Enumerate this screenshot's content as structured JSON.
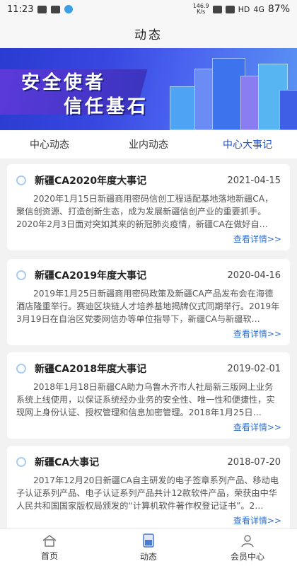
{
  "status": {
    "time": "11:23",
    "net_speed_top": "146.9",
    "net_speed_bottom": "K/s",
    "hd": "HD",
    "signal": "4G",
    "battery": "87%"
  },
  "header": {
    "title": "动态"
  },
  "banner": {
    "line1": "安全使者",
    "line2": "信任基石"
  },
  "tabs": [
    {
      "label": "中心动态",
      "active": false
    },
    {
      "label": "业内动态",
      "active": false
    },
    {
      "label": "中心大事记",
      "active": true
    }
  ],
  "colors": {
    "accent": "#1f50c8",
    "link": "#2f6fd3"
  },
  "cards": [
    {
      "title": "新疆CA2020年度大事记",
      "date": "2021-04-15",
      "body": "2020年1月15日新疆商用密码信创工程适配基地落地新疆CA，聚信创资源、打造创新生态，成为发展新疆信创产业的重要抓手。2020年2月3日面对突如其来的新冠肺炎疫情，新疆CA在做好自…",
      "more": "查看详情>>"
    },
    {
      "title": "新疆CA2019年度大事记",
      "date": "2020-04-16",
      "body": "2019年1月25日新疆商用密码政策及新疆CA产品发布会在海德酒店隆重举行。赛迪区块链人才培养基地揭牌仪式同期举行。2019年3月19日在自治区党委网信办等单位指导下，新疆CA与新疆软…",
      "more": "查看详情>>"
    },
    {
      "title": "新疆CA2018年度大事记",
      "date": "2019-02-01",
      "body": "2018年1月18日新疆CA助力乌鲁木齐市人社局新三版网上业务系统上线使用，以保证系统经办业务的安全性、唯一性和便捷性，实现网上身份认证、授权管理和信息加密管理。2018年1月25日…",
      "more": "查看详情>>"
    },
    {
      "title": "新疆CA大事记",
      "date": "2018-07-20",
      "body": "2017年12月20日新疆CA自主研发的电子签章系列产品、移动电子认证系列产品、电子认证系列产品共计12款软件产品，荣获由中华人民共和国国家版权局颁发的“计算机软件著作权登记证书”。2…",
      "more": "查看详情>>"
    }
  ],
  "bottom_nav": [
    {
      "label": "首页",
      "icon": "home-icon"
    },
    {
      "label": "动态",
      "icon": "news-icon"
    },
    {
      "label": "会员中心",
      "icon": "user-icon"
    }
  ]
}
